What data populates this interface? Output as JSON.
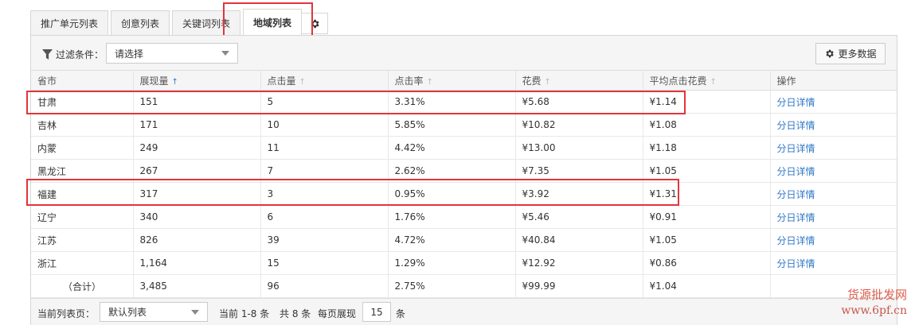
{
  "tabs": [
    {
      "label": "推广单元列表"
    },
    {
      "label": "创意列表"
    },
    {
      "label": "关键词列表"
    },
    {
      "label": "地域列表"
    }
  ],
  "filter": {
    "label": "过滤条件：",
    "select_value": "请选择"
  },
  "more_button": {
    "label": "更多数据"
  },
  "table": {
    "headers": [
      "省市",
      "展现量",
      "点击量",
      "点击率",
      "花费",
      "平均点击花费",
      "操作"
    ],
    "rows": [
      [
        "甘肃",
        "151",
        "5",
        "3.31%",
        "¥5.68",
        "¥1.14",
        "分日详情"
      ],
      [
        "吉林",
        "171",
        "10",
        "5.85%",
        "¥10.82",
        "¥1.08",
        "分日详情"
      ],
      [
        "内蒙",
        "249",
        "11",
        "4.42%",
        "¥13.00",
        "¥1.18",
        "分日详情"
      ],
      [
        "黑龙江",
        "267",
        "7",
        "2.62%",
        "¥7.35",
        "¥1.05",
        "分日详情"
      ],
      [
        "福建",
        "317",
        "3",
        "0.95%",
        "¥3.92",
        "¥1.31",
        "分日详情"
      ],
      [
        "辽宁",
        "340",
        "6",
        "1.76%",
        "¥5.46",
        "¥0.91",
        "分日详情"
      ],
      [
        "江苏",
        "826",
        "39",
        "4.72%",
        "¥40.84",
        "¥1.05",
        "分日详情"
      ],
      [
        "浙江",
        "1,164",
        "15",
        "1.29%",
        "¥12.92",
        "¥0.86",
        "分日详情"
      ]
    ],
    "total": [
      "（合计）",
      "3,485",
      "96",
      "2.75%",
      "¥99.99",
      "¥1.04",
      ""
    ]
  },
  "footer": {
    "current_page_label": "当前列表页：",
    "page_select_value": "默认列表",
    "current_range": "当前 1-8 条",
    "total_count": "共 8 条",
    "per_page_label": "每页展现",
    "per_page_value": "15",
    "unit": "条"
  },
  "watermark": {
    "text": "货源批发网",
    "url": "www.6pf.cn"
  }
}
